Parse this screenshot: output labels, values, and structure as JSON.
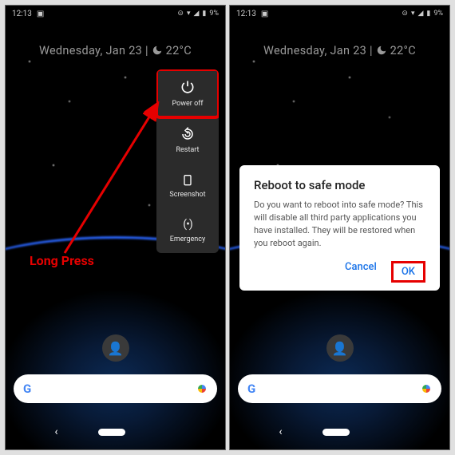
{
  "annotation": {
    "long_press": "Long Press"
  },
  "statusbar": {
    "time": "12:13",
    "battery": "9%"
  },
  "dateweather": {
    "day": "Wednesday, Jan 23",
    "separator": " | ",
    "temp": "22°C"
  },
  "power_menu": {
    "items": [
      "Power off",
      "Restart",
      "Screenshot",
      "Emergency"
    ]
  },
  "dialog": {
    "title": "Reboot to safe mode",
    "body": "Do you want to reboot into safe mode? This will disable all third party applications you have installed. They will be restored when you reboot again.",
    "cancel": "Cancel",
    "ok": "OK"
  }
}
